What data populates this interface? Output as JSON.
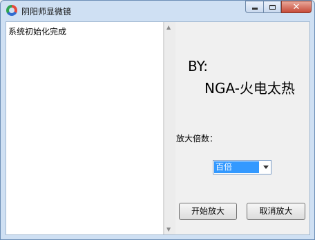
{
  "window": {
    "title": "阴阳师显微镜",
    "controls": {
      "minimize": "minimize",
      "maximize": "maximize",
      "close": "close"
    }
  },
  "log": {
    "text": "系统初始化完成"
  },
  "credits": {
    "by_label": "BY:",
    "author": "NGA-火电太热"
  },
  "zoom": {
    "label": "放大倍数：",
    "selected": "百倍"
  },
  "buttons": {
    "start": "开始放大",
    "cancel": "取消放大"
  },
  "colors": {
    "title_bar": "#cfe0f3",
    "selection": "#3399ff",
    "close_button": "#c74a38"
  }
}
